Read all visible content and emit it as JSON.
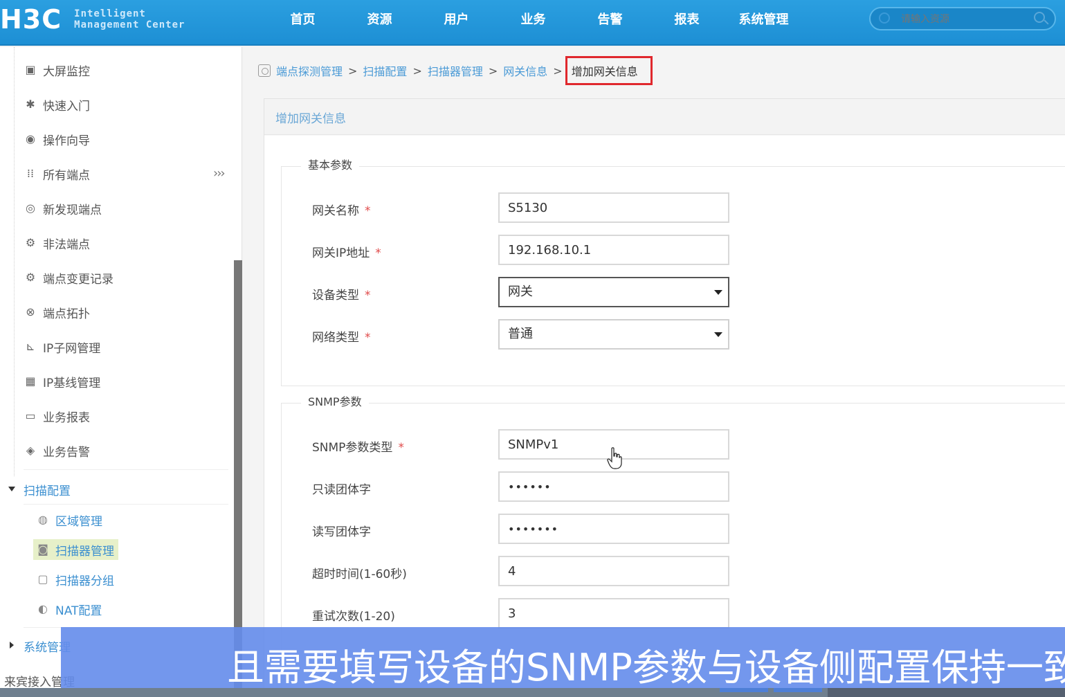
{
  "header": {
    "logo": "H3C",
    "logo_sub_line1": "Intelligent",
    "logo_sub_line2": "Management Center",
    "nav": [
      "首页",
      "资源",
      "用户",
      "业务",
      "告警",
      "报表",
      "系统管理"
    ],
    "search_placeholder": "请输入资源"
  },
  "sidebar": {
    "items": [
      {
        "label": "大屏监控",
        "icon": "monitor-icon"
      },
      {
        "label": "快速入门",
        "icon": "gear-icon"
      },
      {
        "label": "操作向导",
        "icon": "wizard-icon"
      },
      {
        "label": "所有端点",
        "icon": "grid-icon"
      },
      {
        "label": "新发现端点",
        "icon": "discover-icon"
      },
      {
        "label": "非法端点",
        "icon": "illegal-icon"
      },
      {
        "label": "端点变更记录",
        "icon": "record-icon"
      },
      {
        "label": "端点拓扑",
        "icon": "topology-icon"
      },
      {
        "label": "IP子网管理",
        "icon": "subnet-icon"
      },
      {
        "label": "IP基线管理",
        "icon": "baseline-icon"
      },
      {
        "label": "业务报表",
        "icon": "report-icon"
      },
      {
        "label": "业务告警",
        "icon": "alarm-icon"
      }
    ],
    "expand_glyph": "›››",
    "group": "扫描配置",
    "sub_items": [
      {
        "label": "区域管理",
        "icon": "region-icon"
      },
      {
        "label": "扫描器管理",
        "icon": "scanner-icon"
      },
      {
        "label": "扫描器分组",
        "icon": "group-icon"
      },
      {
        "label": "NAT配置",
        "icon": "nat-icon"
      }
    ],
    "collapsed_group": "系统管理",
    "bottom_item": "来宾接入管理"
  },
  "breadcrumb": [
    "端点探测管理",
    "扫描配置",
    "扫描器管理",
    "网关信息",
    "增加网关信息"
  ],
  "panel": {
    "title": "增加网关信息",
    "basic": {
      "legend": "基本参数",
      "fields": [
        {
          "label": "网关名称",
          "value": "S5130",
          "required": "*"
        },
        {
          "label": "网关IP地址",
          "value": "192.168.10.1",
          "required": "*"
        },
        {
          "label": "设备类型",
          "value": "网关",
          "required": "*"
        },
        {
          "label": "网络类型",
          "value": "普通",
          "required": "*"
        }
      ]
    },
    "snmp": {
      "legend": "SNMP参数",
      "fields": [
        {
          "label": "SNMP参数类型",
          "value": "SNMPv1",
          "required": "*"
        },
        {
          "label": "只读团体字",
          "value": "••••••"
        },
        {
          "label": "读写团体字",
          "value": "•••••••"
        },
        {
          "label": "超时时间(1-60秒)",
          "value": "4"
        },
        {
          "label": "重试次数(1-20)",
          "value": "3"
        }
      ]
    }
  },
  "subtitle": "且需要填写设备的SNMP参数与设备侧配置保持一致",
  "colors": {
    "header_blue": "#2b9fe0",
    "link_blue": "#4a9ad6",
    "highlight_red": "#e0282d",
    "subtitle_bg": "#648ceb"
  }
}
